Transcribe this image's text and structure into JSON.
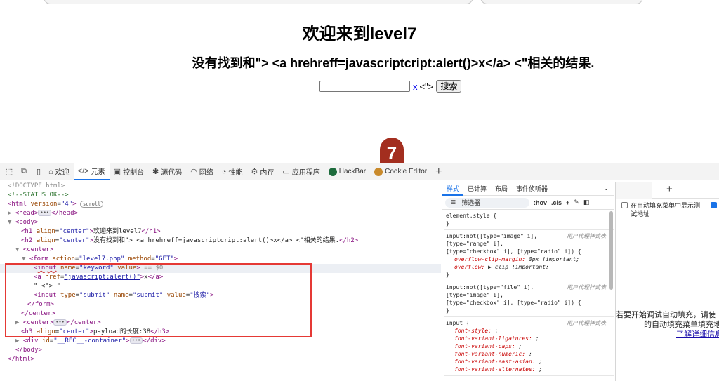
{
  "page": {
    "title": "欢迎来到level7",
    "result_text": "没有找到和\"> <a hrehreff=javascriptcript:alert()>x</a> <\"相关的结果.",
    "form": {
      "keyword_value": "",
      "link_text": "x",
      "after_link": "<\">",
      "submit_label": "搜索"
    },
    "badge": "7"
  },
  "devtools": {
    "tabs": [
      {
        "label": "欢迎",
        "icon": "welcome-icon"
      },
      {
        "label": "元素",
        "icon": "elements-icon"
      },
      {
        "label": "控制台",
        "icon": "console-icon"
      },
      {
        "label": "源代码",
        "icon": "sources-icon"
      },
      {
        "label": "网络",
        "icon": "network-icon"
      },
      {
        "label": "性能",
        "icon": "performance-icon"
      },
      {
        "label": "内存",
        "icon": "memory-icon"
      },
      {
        "label": "应用程序",
        "icon": "application-icon"
      },
      {
        "label": "HackBar",
        "icon": "hackbar-icon"
      },
      {
        "label": "Cookie Editor",
        "icon": "cookie-icon"
      }
    ],
    "active_tab": "元素",
    "tree": {
      "doctype": "<!DOCTYPE html>",
      "comment": "<!--STATUS OK-->",
      "html_open": "<html",
      "html_attr": "version",
      "html_val": "\"4\"",
      "scroll_badge": "scroll",
      "head": "<head>",
      "head_close": "</head>",
      "body": "<body>",
      "h1_open": "<h1",
      "h1_attr": "align",
      "h1_val": "\"center\"",
      "h1_text": "欢迎来到level7",
      "h1_close": "</h1>",
      "h2_open": "<h2",
      "h2_val": "\"center\"",
      "h2_text": "没有找到和\"> <a hrehreff=javascriptcript:alert()>x</a> <\"相关的结果.",
      "h2_close": "</h2>",
      "center": "<center>",
      "form_open": "<form",
      "form_action_attr": "action",
      "form_action_val": "\"level7.php\"",
      "form_method_attr": "method",
      "form_method_val": "\"GET\"",
      "input1_tag": "input",
      "input1_name_attr": "name",
      "input1_name_val": "\"keyword\"",
      "input1_value_attr": "value",
      "input1_eq": "== $0",
      "a_open": "<a",
      "a_href_attr": "href",
      "a_href_val": "\"javascript:alert()\"",
      "a_text": "x",
      "a_close": "</a>",
      "text_node": "\" <\"> \"",
      "input2_open": "<input",
      "input2_type_attr": "type",
      "input2_type_val": "\"submit\"",
      "input2_name_attr": "name",
      "input2_name_val": "\"submit\"",
      "input2_value_attr": "value",
      "input2_value_val": "\"搜索\"",
      "form_close": "</form>",
      "center_close": "</center>",
      "center2": "<center>",
      "center2_close": "</center>",
      "h3_open": "<h3",
      "h3_val": "\"center\"",
      "h3_text": "payload的长度:38",
      "h3_close": "</h3>",
      "div_open": "<div",
      "div_attr": "id",
      "div_val": "\"__REC__-container\"",
      "div_close": "</div>",
      "body_close": "</body>",
      "html_close": "</html>"
    },
    "styles_pane": {
      "tabs": [
        "样式",
        "已计算",
        "布局",
        "事件侦听器"
      ],
      "filter_placeholder": "筛选器",
      "tools": [
        ":hov",
        ".cls"
      ],
      "element_style": "element.style {",
      "rules": [
        {
          "selector": "input:not([type=\"image\" i],\n[type=\"range\" i],\n[type=\"checkbox\" i], [type=\"radio\" i]) {",
          "source": "用户代理样式表",
          "props": [
            {
              "name": "overflow-clip-margin",
              "value": "0px !important;"
            },
            {
              "name": "overflow",
              "value": "▶ clip !important;"
            }
          ]
        },
        {
          "selector": "input:not([type=\"file\" i],\n[type=\"image\" i],\n[type=\"checkbox\" i], [type=\"radio\" i]) {",
          "source": "用户代理样式表",
          "props": []
        },
        {
          "selector": "input {",
          "source": "用户代理样式表",
          "props": [
            {
              "name": "font-style",
              "value": ";"
            },
            {
              "name": "font-variant-ligatures",
              "value": ";"
            },
            {
              "name": "font-variant-caps",
              "value": ";"
            },
            {
              "name": "font-variant-numeric",
              "value": ";"
            },
            {
              "name": "font-variant-east-asian",
              "value": ";"
            },
            {
              "name": "font-variant-alternates",
              "value": ";"
            }
          ]
        }
      ]
    },
    "autofill_pane": {
      "checkbox_label": "在自动填充菜单中显示测试地址",
      "message_line1": "若要开始调试自动填充，请使",
      "message_line2": "的自动填充菜单填充地",
      "link": "了解详细信息"
    }
  },
  "colors": {
    "accent": "#1a73e8",
    "highlight_box": "#e53935",
    "badge": "#a32e1f"
  }
}
